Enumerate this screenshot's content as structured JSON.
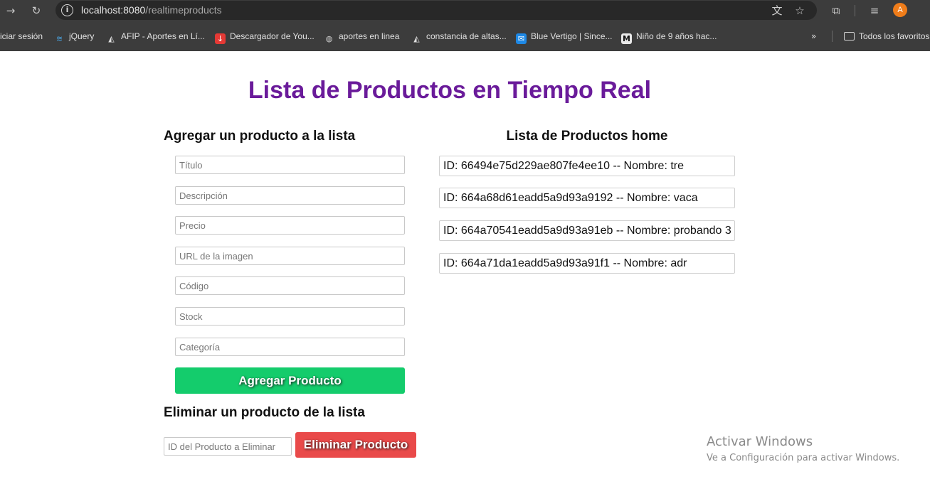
{
  "browser": {
    "url_host": "localhost:8080",
    "url_path": "/realtimeproducts",
    "avatar_letter": "A",
    "icons": {
      "forward": "→",
      "reload": "↻",
      "info": "i",
      "translate": "文",
      "star": "☆",
      "extensions": "⧉",
      "media": "≡",
      "more": "»"
    },
    "bookmarks": [
      {
        "label": "iciar sesión",
        "icon": ""
      },
      {
        "label": "jQuery",
        "icon": "jquery-icon"
      },
      {
        "label": "AFIP - Aportes en Lí...",
        "icon": "afip-icon"
      },
      {
        "label": "Descargador de You...",
        "icon": "download-icon"
      },
      {
        "label": "aportes en linea",
        "icon": "globe-icon"
      },
      {
        "label": "constancia de altas...",
        "icon": "afip-icon"
      },
      {
        "label": "Blue Vertigo | Since...",
        "icon": "mail-icon"
      },
      {
        "label": "Niño de 9 años hac...",
        "icon": "m-icon"
      }
    ],
    "all_bookmarks_label": "Todos los favoritos"
  },
  "page": {
    "title": "Lista de Productos en Tiempo Real",
    "add_section": {
      "heading": "Agregar un producto a la lista",
      "fields": {
        "title_placeholder": "Título",
        "description_placeholder": "Descripción",
        "price_placeholder": "Precio",
        "image_placeholder": "URL de la imagen",
        "code_placeholder": "Código",
        "stock_placeholder": "Stock",
        "category_placeholder": "Categoría"
      },
      "submit_label": "Agregar Producto"
    },
    "delete_section": {
      "heading": "Eliminar un producto de la lista",
      "id_placeholder": "ID del Producto a Eliminar",
      "submit_label": "Eliminar Producto"
    },
    "list_section": {
      "heading": "Lista de Productos home",
      "products": [
        "ID: 66494e75d229ae807fe4ee10 -- Nombre: tre",
        "ID: 664a68d61eadd5a9d93a9192 -- Nombre: vaca",
        "ID: 664a70541eadd5a9d93a91eb -- Nombre: probando 3",
        "ID: 664a71da1eadd5a9d93a91f1 -- Nombre: adr"
      ]
    }
  },
  "os_watermark": {
    "line1": "Activar Windows",
    "line2": "Ve a Configuración para activar Windows."
  },
  "colors": {
    "title_purple": "#6a1b9a",
    "add_green": "#14cc6c",
    "delete_red": "#e94a4a"
  }
}
